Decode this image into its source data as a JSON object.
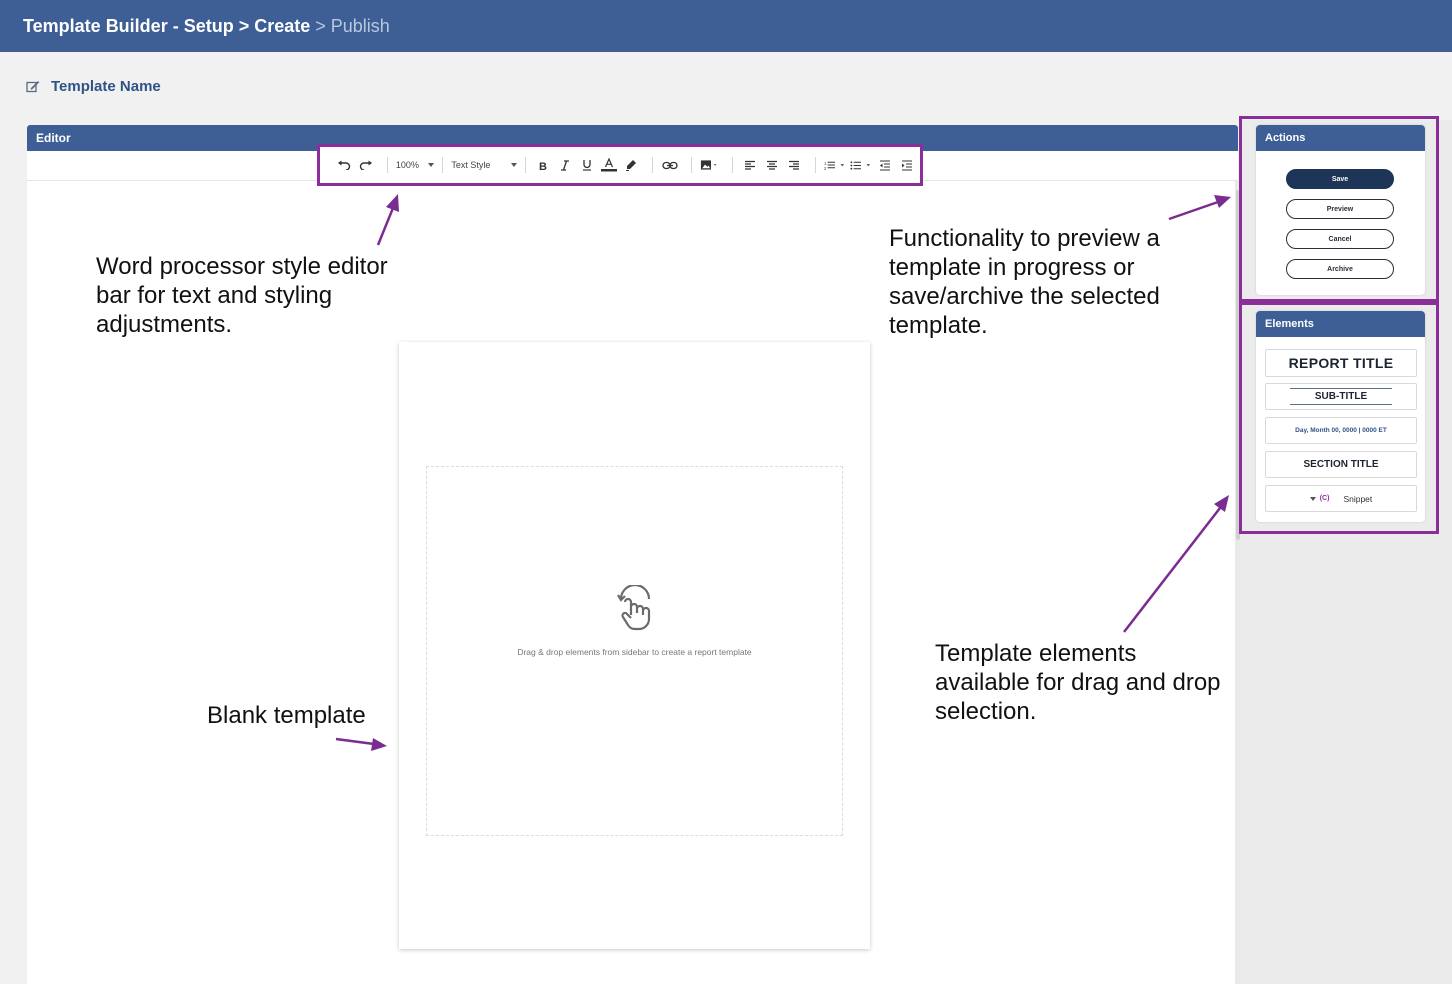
{
  "header": {
    "app_title": "Template Builder",
    "dash": "-",
    "steps": [
      "Setup",
      "Create",
      "Publish"
    ],
    "separator": ">"
  },
  "template_name": {
    "label": "Template Name",
    "icon": "edit-icon"
  },
  "editor": {
    "title": "Editor",
    "toolbar": {
      "zoom": "100%",
      "text_style": "Text Style",
      "icons": [
        "undo-icon",
        "redo-icon",
        "bold-icon",
        "italic-icon",
        "underline-icon",
        "font-color-icon",
        "highlight-icon",
        "link-icon",
        "image-icon",
        "align-left-icon",
        "align-center-icon",
        "align-right-icon",
        "numbered-list-icon",
        "bullet-list-icon",
        "indent-decrease-icon",
        "indent-increase-icon"
      ]
    },
    "drop_hint": "Drag & drop elements from sidebar to create a report template"
  },
  "actions": {
    "title": "Actions",
    "save": "Save",
    "preview": "Preview",
    "cancel": "Cancel",
    "archive": "Archive"
  },
  "elements": {
    "title": "Elements",
    "report_title": "REPORT TITLE",
    "sub_title": "SUB-TITLE",
    "date_line": "Day, Month 00, 0000  |  0000 ET",
    "section_title": "SECTION TITLE",
    "snippet_tag": "(C)",
    "snippet_label": "Snippet"
  },
  "annotations": {
    "toolbar": [
      "Word processor style editor",
      "bar for text and styling",
      "adjustments."
    ],
    "actions": [
      "Functionality to preview a",
      "template in progress or",
      "save/archive the selected",
      "template."
    ],
    "blank": [
      "Blank template"
    ],
    "elements": [
      "Template elements",
      "available for drag and drop",
      "selection."
    ]
  },
  "colors": {
    "header_blue": "#3d5f95",
    "highlight_purple": "#8b2e9a",
    "save_button": "#1d3557"
  }
}
